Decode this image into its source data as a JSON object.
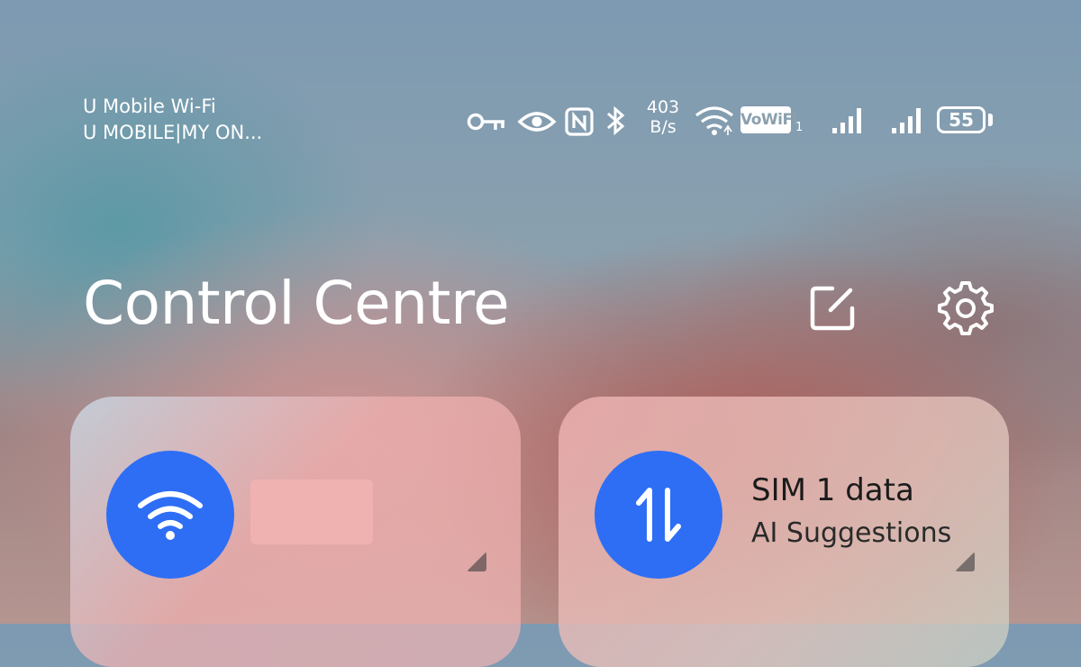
{
  "status_bar": {
    "network_name": "U Mobile Wi-Fi",
    "carrier": "U MOBILE|MY ON...",
    "speed_value": "403",
    "speed_unit": "B/s",
    "vowifi_label": "VoWiFi",
    "vowifi_sim": "1",
    "battery_level": "55",
    "icons": [
      "vpn-key-icon",
      "eye-icon",
      "nfc-icon",
      "bluetooth-icon",
      "wifi-icon",
      "signal-icon",
      "signal-icon",
      "battery-icon"
    ]
  },
  "header": {
    "title": "Control Centre",
    "edit_icon": "edit-icon",
    "settings_icon": "gear-icon"
  },
  "tiles": [
    {
      "title": "",
      "subtitle": "",
      "icon": "wifi-icon",
      "accent": "#2e6ef5"
    },
    {
      "title": "SIM 1 data",
      "subtitle": "AI Suggestions",
      "icon": "data-transfer-icon",
      "accent": "#2e6ef5"
    }
  ]
}
